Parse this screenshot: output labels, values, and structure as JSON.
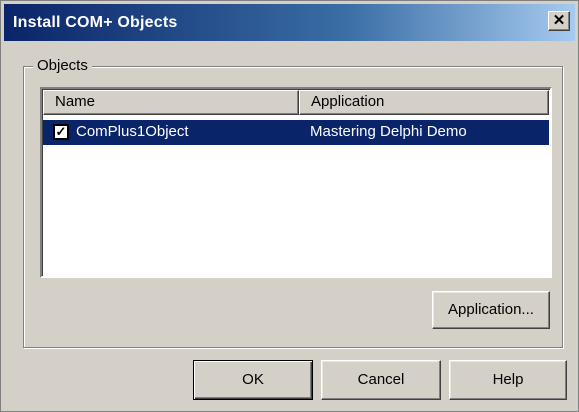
{
  "window": {
    "title": "Install COM+ Objects",
    "close_glyph": "✕"
  },
  "group": {
    "label": "Objects"
  },
  "list": {
    "columns": [
      "Name",
      "Application"
    ],
    "rows": [
      {
        "checked": true,
        "check_glyph": "✓",
        "name": "ComPlus1Object",
        "application": "Mastering Delphi Demo"
      }
    ]
  },
  "buttons": {
    "application": "Application...",
    "ok": "OK",
    "cancel": "Cancel",
    "help": "Help"
  },
  "colors": {
    "title_bar": "#0a246a",
    "selection": "#0a246a",
    "face": "#d4d0c8"
  }
}
